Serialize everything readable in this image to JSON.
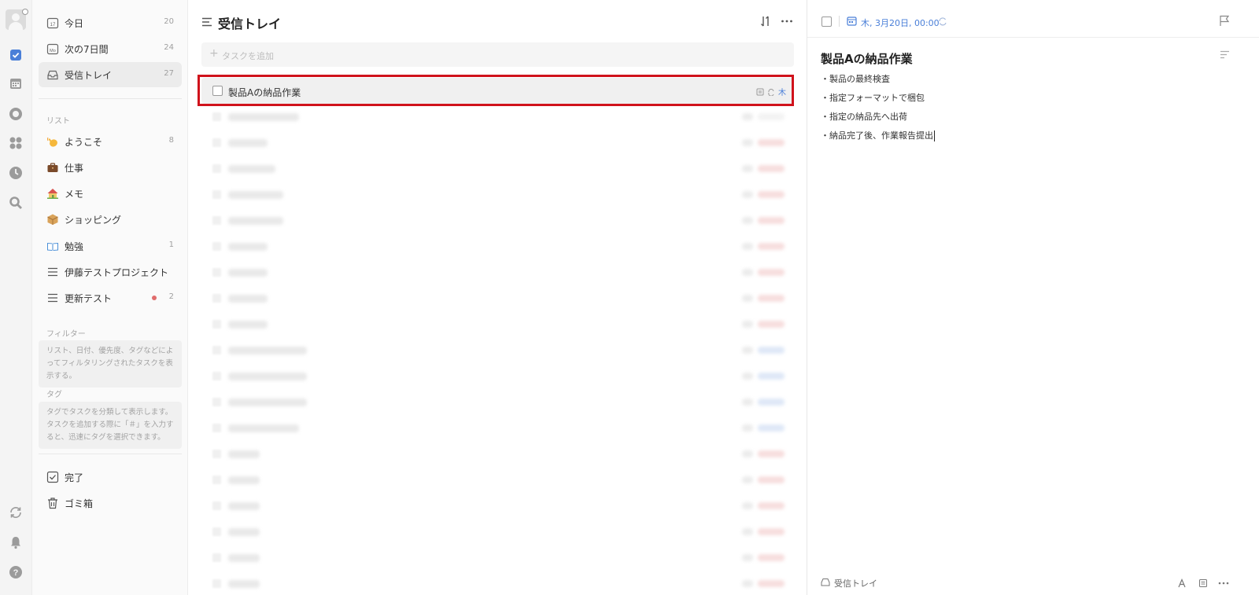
{
  "sidebar": {
    "nav": [
      {
        "label": "今日",
        "count": "20"
      },
      {
        "label": "次の7日間",
        "count": "24"
      },
      {
        "label": "受信トレイ",
        "count": "27"
      }
    ],
    "lists_title": "リスト",
    "lists": [
      {
        "label": "ようこそ",
        "count": "8",
        "icon": "waving-hand-icon"
      },
      {
        "label": "仕事",
        "count": "",
        "icon": "briefcase-icon"
      },
      {
        "label": "メモ",
        "count": "",
        "icon": "house-icon"
      },
      {
        "label": "ショッピング",
        "count": "",
        "icon": "package-icon"
      },
      {
        "label": "勉強",
        "count": "1",
        "icon": "book-icon"
      },
      {
        "label": "伊藤テストプロジェクト",
        "count": "",
        "icon": "list-icon"
      },
      {
        "label": "更新テスト",
        "count": "2",
        "icon": "list-icon"
      }
    ],
    "filters_title": "フィルター",
    "filters_hint": "リスト、日付、優先度、タグなどによってフィルタリングされたタスクを表示する。",
    "tags_title": "タグ",
    "tags_hint": "タグでタスクを分類して表示します。タスクを追加する際に「＃」を入力すると、迅速にタグを選択できます。",
    "bottom": [
      {
        "label": "完了"
      },
      {
        "label": "ゴミ箱"
      }
    ]
  },
  "main": {
    "title": "受信トレイ",
    "add_placeholder": "タスクを追加",
    "selected_task": {
      "title": "製品Aの納品作業",
      "due": "木"
    }
  },
  "detail": {
    "date": "木, 3月20日, 00:00",
    "title": "製品Aの納品作業",
    "lines": [
      "・製品の最終検査",
      "・指定フォーマットで梱包",
      "・指定の納品先へ出荷",
      "・納品完了後、作業報告提出"
    ],
    "footer_list": "受信トレイ"
  },
  "colors": {
    "accent": "#4a7fd8",
    "highlight": "#d0121b",
    "badge_dot": "#e06c6c"
  }
}
